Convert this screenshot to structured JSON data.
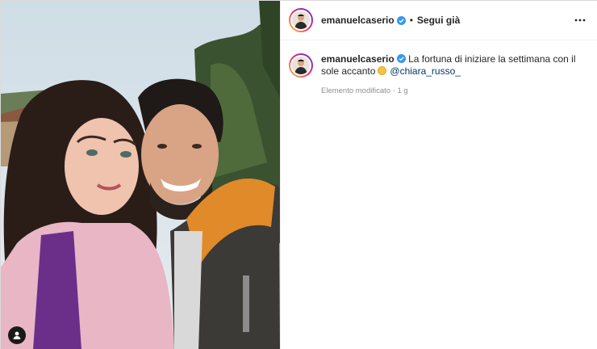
{
  "post": {
    "username": "emanuelcaserio",
    "separator": "•",
    "follow_label": "Segui già",
    "caption_text": "La fortuna di iniziare la settimana con il sole accanto",
    "mention": "@chiara_russo_",
    "meta_text": "Elemento modificato · 1 g"
  },
  "icons": {
    "verified": "verified-badge-icon",
    "more": "more-options-icon",
    "tag": "user-tag-icon",
    "emoji": "sun-emoji-icon"
  },
  "colors": {
    "verified_blue": "#3897f0",
    "mention": "#00376b",
    "meta_gray": "#8e8e8e"
  }
}
